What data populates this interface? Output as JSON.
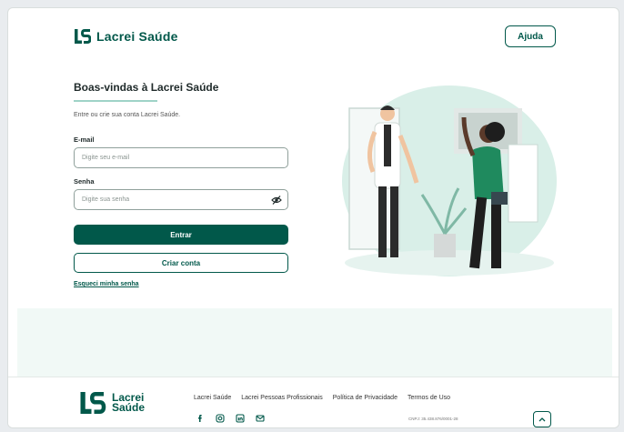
{
  "brand": {
    "name": "Lacrei Saúde",
    "footer_name_line1": "Lacrei",
    "footer_name_line2": "Saúde",
    "color": "#01584a"
  },
  "header": {
    "help_label": "Ajuda"
  },
  "login": {
    "title": "Boas-vindas à Lacrei Saúde",
    "subtitle": "Entre ou crie sua conta Lacrei Saúde.",
    "email_label": "E-mail",
    "email_placeholder": "Digite seu e-mail",
    "password_label": "Senha",
    "password_placeholder": "Digite sua senha",
    "submit_label": "Entrar",
    "create_label": "Criar conta",
    "forgot_label": "Esqueci minha senha"
  },
  "footer": {
    "links": [
      "Lacrei Saúde",
      "Lacrei Pessoas Profissionais",
      "Política de Privacidade",
      "Termos de Uso"
    ],
    "social_icons": [
      "facebook-icon",
      "instagram-icon",
      "linkedin-icon",
      "email-icon"
    ],
    "cnpj": "CNPJ: 35.438.876/0001-28"
  },
  "colors": {
    "accent": "#01584a",
    "illustration_bg": "#d9efe8"
  }
}
